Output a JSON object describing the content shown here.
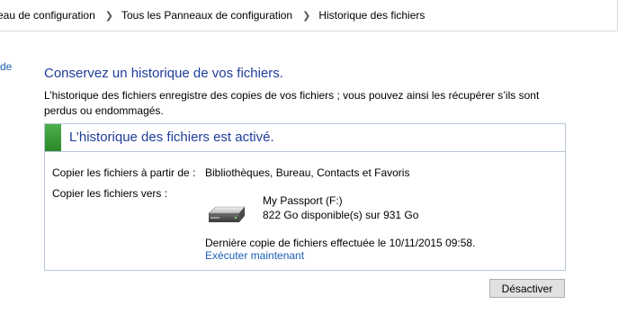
{
  "breadcrumb": {
    "items": [
      "eau de configuration",
      "Tous les Panneaux de configuration",
      "Historique des fichiers"
    ]
  },
  "left_nav": {
    "fragment": "de"
  },
  "main": {
    "heading": "Conservez un historique de vos fichiers.",
    "description": "L’historique des fichiers enregistre des copies de vos fichiers ; vous pouvez ainsi les récupérer s’ils sont perdus ou endommagés.",
    "status": {
      "title": "L’historique des fichiers est activé.",
      "status_color": "#2e8b2e",
      "copy_from_label": "Copier les fichiers à partir de :",
      "copy_from_value": "Bibliothèques, Bureau, Contacts et Favoris",
      "copy_to_label": "Copier les fichiers vers :",
      "drive_name": "My Passport (F:)",
      "drive_space": "822 Go disponible(s) sur 931 Go",
      "drive_icon": "external-drive-icon",
      "last_copy": "Dernière copie de fichiers effectuée le 10/11/2015 09:58.",
      "run_now_link": "Exécuter maintenant"
    },
    "disable_button": "Désactiver"
  }
}
